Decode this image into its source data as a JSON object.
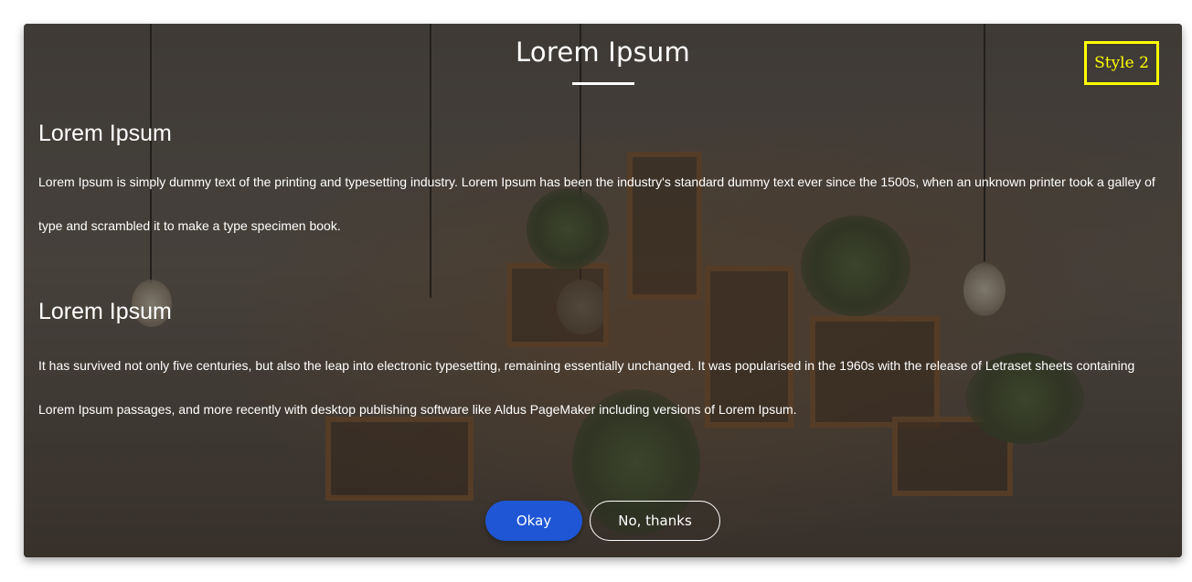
{
  "modal": {
    "title": "Lorem Ipsum",
    "style_badge": "Style 2",
    "sections": [
      {
        "heading": "Lorem Ipsum",
        "text": "Lorem Ipsum is simply dummy text of the printing and typesetting industry. Lorem Ipsum has been the industry's standard dummy text ever since the 1500s, when an unknown printer took a galley of type and scrambled it to make a type specimen book."
      },
      {
        "heading": "Lorem Ipsum",
        "text": "It has survived not only five centuries, but also the leap into electronic typesetting, remaining essentially unchanged. It was popularised in the 1960s with the release of Letraset sheets containing Lorem Ipsum passages, and more recently with desktop publishing software like Aldus PageMaker including versions of Lorem Ipsum."
      }
    ],
    "buttons": {
      "okay_label": "Okay",
      "no_thanks_label": "No, thanks"
    }
  },
  "colors": {
    "accent": "#1e56d6",
    "badge": "#ffff00",
    "overlay": "#282421"
  }
}
